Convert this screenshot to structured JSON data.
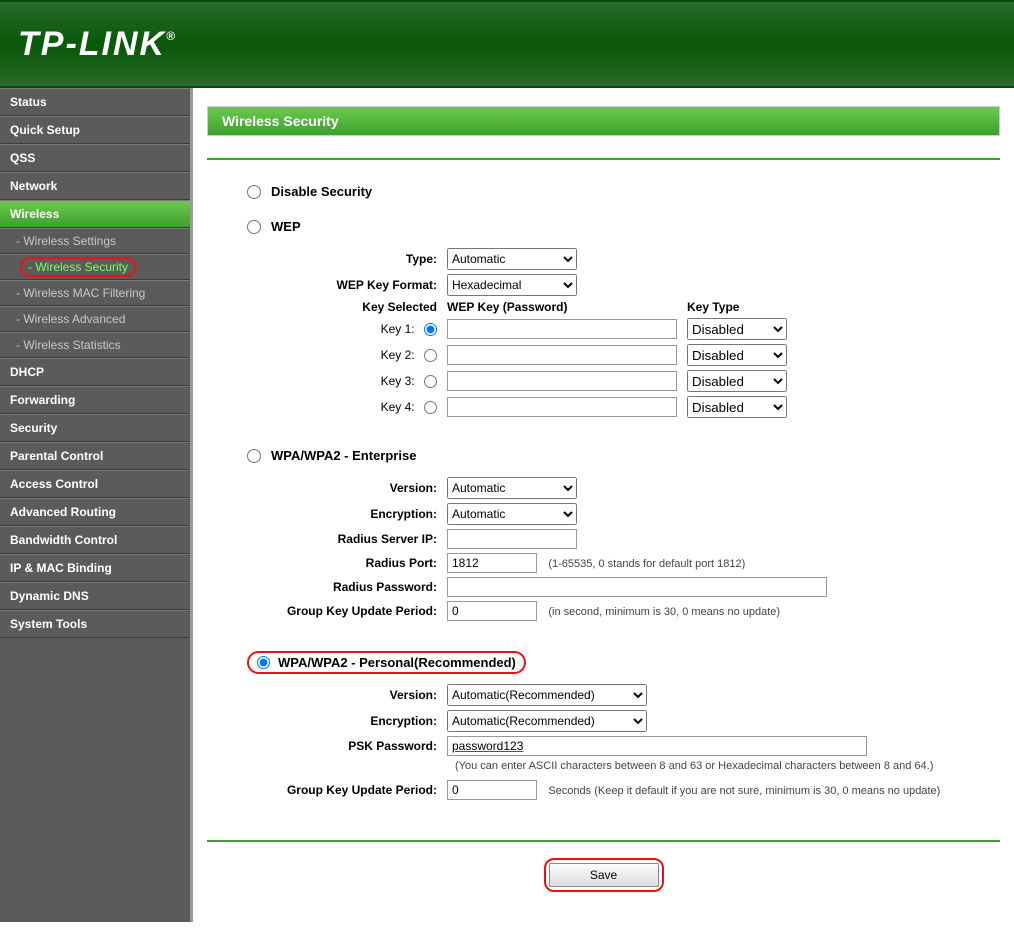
{
  "brand": "TP-LINK",
  "sidebar": {
    "items": [
      {
        "label": "Status"
      },
      {
        "label": "Quick Setup"
      },
      {
        "label": "QSS"
      },
      {
        "label": "Network"
      },
      {
        "label": "Wireless",
        "active": true
      },
      {
        "label": "DHCP"
      },
      {
        "label": "Forwarding"
      },
      {
        "label": "Security"
      },
      {
        "label": "Parental Control"
      },
      {
        "label": "Access Control"
      },
      {
        "label": "Advanced Routing"
      },
      {
        "label": "Bandwidth Control"
      },
      {
        "label": "IP & MAC Binding"
      },
      {
        "label": "Dynamic DNS"
      },
      {
        "label": "System Tools"
      }
    ],
    "wireless_sub": [
      {
        "label": "- Wireless Settings"
      },
      {
        "label": "- Wireless Security",
        "active": true
      },
      {
        "label": "- Wireless MAC Filtering"
      },
      {
        "label": "- Wireless Advanced"
      },
      {
        "label": "- Wireless Statistics"
      }
    ]
  },
  "page": {
    "title": "Wireless Security",
    "disable_label": "Disable Security",
    "wep": {
      "title": "WEP",
      "type_label": "Type:",
      "type_value": "Automatic",
      "format_label": "WEP Key Format:",
      "format_value": "Hexadecimal",
      "key_selected_label": "Key Selected",
      "wep_key_label": "WEP Key (Password)",
      "key_type_label": "Key Type",
      "keys": [
        {
          "label": "Key 1:",
          "value": "",
          "type": "Disabled"
        },
        {
          "label": "Key 2:",
          "value": "",
          "type": "Disabled"
        },
        {
          "label": "Key 3:",
          "value": "",
          "type": "Disabled"
        },
        {
          "label": "Key 4:",
          "value": "",
          "type": "Disabled"
        }
      ]
    },
    "wpa_ent": {
      "title": "WPA/WPA2 - Enterprise",
      "version_label": "Version:",
      "version_value": "Automatic",
      "encryption_label": "Encryption:",
      "encryption_value": "Automatic",
      "radius_ip_label": "Radius Server IP:",
      "radius_ip_value": "",
      "radius_port_label": "Radius Port:",
      "radius_port_value": "1812",
      "radius_port_note": "(1-65535, 0 stands for default port 1812)",
      "radius_pw_label": "Radius Password:",
      "radius_pw_value": "",
      "group_label": "Group Key Update Period:",
      "group_value": "0",
      "group_note": "(in second, minimum is 30, 0 means no update)"
    },
    "wpa_psk": {
      "title": "WPA/WPA2 - Personal(Recommended)",
      "version_label": "Version:",
      "version_value": "Automatic(Recommended)",
      "encryption_label": "Encryption:",
      "encryption_value": "Automatic(Recommended)",
      "psk_label": "PSK Password:",
      "psk_value": "password123",
      "psk_note": "(You can enter ASCII characters between 8 and 63 or Hexadecimal characters between 8 and 64.)",
      "group_label": "Group Key Update Period:",
      "group_value": "0",
      "group_note": "Seconds (Keep it default if you are not sure, minimum is 30, 0 means no update)"
    },
    "save_label": "Save"
  }
}
